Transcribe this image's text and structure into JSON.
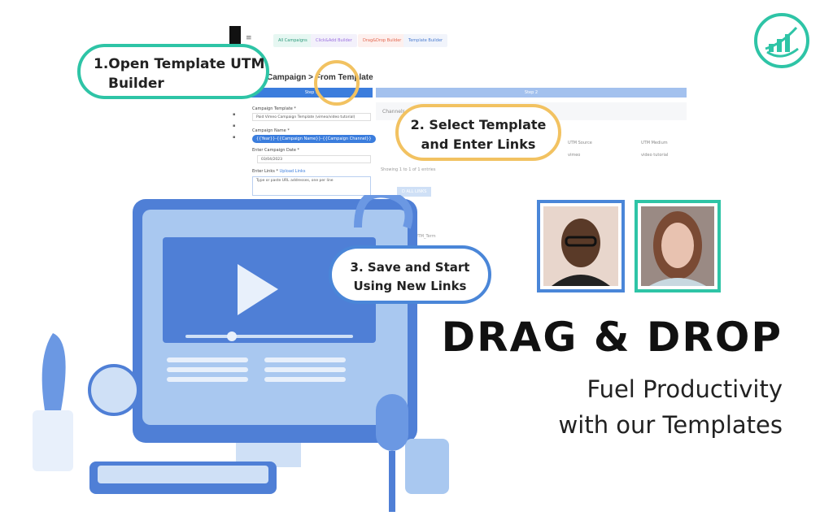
{
  "app": {
    "nav": [
      "All Campaigns",
      "Click&Add Builder",
      "Drag&Drop Builder",
      "Template Builder"
    ],
    "breadcrumb": "Campaign > From Template",
    "steps": [
      "Step 1",
      "Step 2"
    ],
    "form": {
      "template_label": "Campaign Template *",
      "template_value": "Paid Vimeo Campaign Template (vimeo/video tutorial)",
      "name_label": "Campaign Name *",
      "name_value": "{{Year}}-{{Campaign Name}}-{{Campaign Channel}}",
      "date_label": "Enter Campaign Date *",
      "date_value": "03/04/2023",
      "links_label": "Enter Links *",
      "upload_link": "Upload Links",
      "links_placeholder": "Type or paste URL addresses, one per line"
    },
    "channels": {
      "title": "Channels",
      "headers": [
        "UTM Source",
        "UTM Medium"
      ],
      "row": [
        "vimeo",
        "video tutorial"
      ],
      "info": "Showing 1 to 1 of 1 entries",
      "button": "D ALL LINKS",
      "term": "UTM_Term"
    }
  },
  "callouts": {
    "one": [
      "1.Open Template UTM",
      "Builder"
    ],
    "two": [
      "2. Select Template",
      "and Enter Links"
    ],
    "three": [
      "3. Save and Start",
      "Using New Links"
    ]
  },
  "headline": "DRAG & DROP",
  "subline": [
    "Fuel Productivity",
    "with our Templates"
  ],
  "colors": {
    "teal": "#2ec4a6",
    "yellow": "#f2c261",
    "blue": "#4a86d8",
    "monitor": "#4f7fd6"
  }
}
